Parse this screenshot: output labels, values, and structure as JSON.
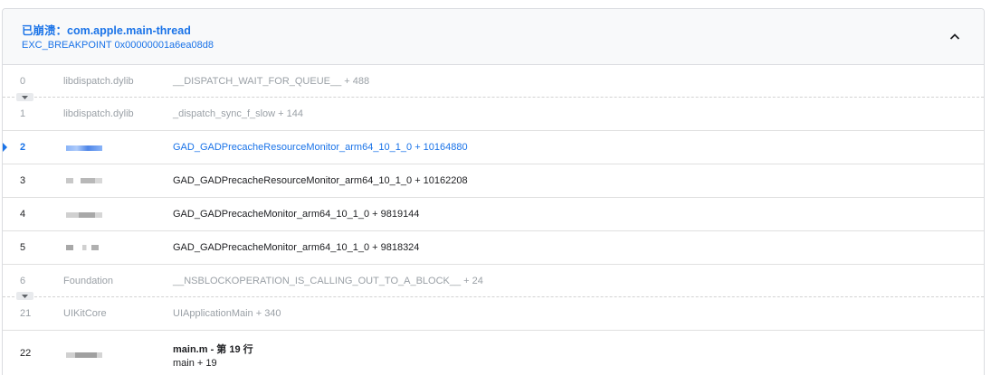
{
  "header": {
    "title": "已崩溃：com.apple.main-thread",
    "exception": "EXC_BREAKPOINT 0x00000001a6ea08d8",
    "collapse_icon": "chevron-up-icon"
  },
  "frames": [
    {
      "index": "0",
      "library": "libdispatch.dylib",
      "symbol": "__DISPATCH_WAIT_FOR_QUEUE__ + 488"
    },
    {
      "index": "1",
      "library": "libdispatch.dylib",
      "symbol": "_dispatch_sync_f_slow + 144"
    },
    {
      "index": "2",
      "library": "",
      "symbol": "GAD_GADPrecacheResourceMonitor_arm64_10_1_0 + 10164880"
    },
    {
      "index": "3",
      "library": "",
      "symbol": "GAD_GADPrecacheResourceMonitor_arm64_10_1_0 + 10162208"
    },
    {
      "index": "4",
      "library": "",
      "symbol": "GAD_GADPrecacheMonitor_arm64_10_1_0 + 9819144"
    },
    {
      "index": "5",
      "library": "",
      "symbol": "GAD_GADPrecacheMonitor_arm64_10_1_0 + 9818324"
    },
    {
      "index": "6",
      "library": "Foundation",
      "symbol": "__NSBLOCKOPERATION_IS_CALLING_OUT_TO_A_BLOCK__ + 24"
    },
    {
      "index": "21",
      "library": "UIKitCore",
      "symbol": "UIApplicationMain + 340"
    },
    {
      "index": "22",
      "library": "",
      "symbol": "main.m - 第 19 行",
      "symbol_sub": "main + 19"
    }
  ],
  "colors": {
    "accent": "#1a73e8",
    "header_bg": "#f8f9fa",
    "dim_text": "#9aa0a6"
  }
}
